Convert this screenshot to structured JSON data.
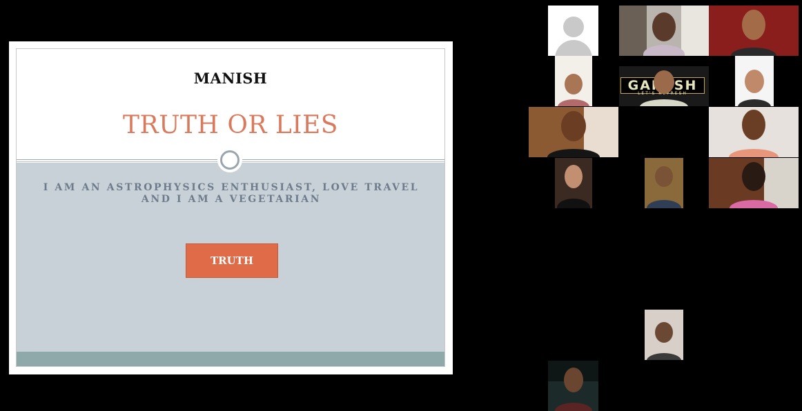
{
  "slide": {
    "presenter_name": "MANISH",
    "title": "TRUTH OR LIES",
    "statement": "I AM AN ASTROPHYSICS ENTHUSIAST, LOVE TRAVEL AND I AM A VEGETARIAN",
    "answer_button": "TRUTH"
  },
  "participants": {
    "ganesh_banner_text": "GANESH",
    "ganesh_banner_subtext": "LET'S REFRESH"
  },
  "colors": {
    "title_accent": "#d97a5c",
    "body_band": "#c8d1d7",
    "button": "#df6b48",
    "footer_band": "#8fa8a9"
  }
}
